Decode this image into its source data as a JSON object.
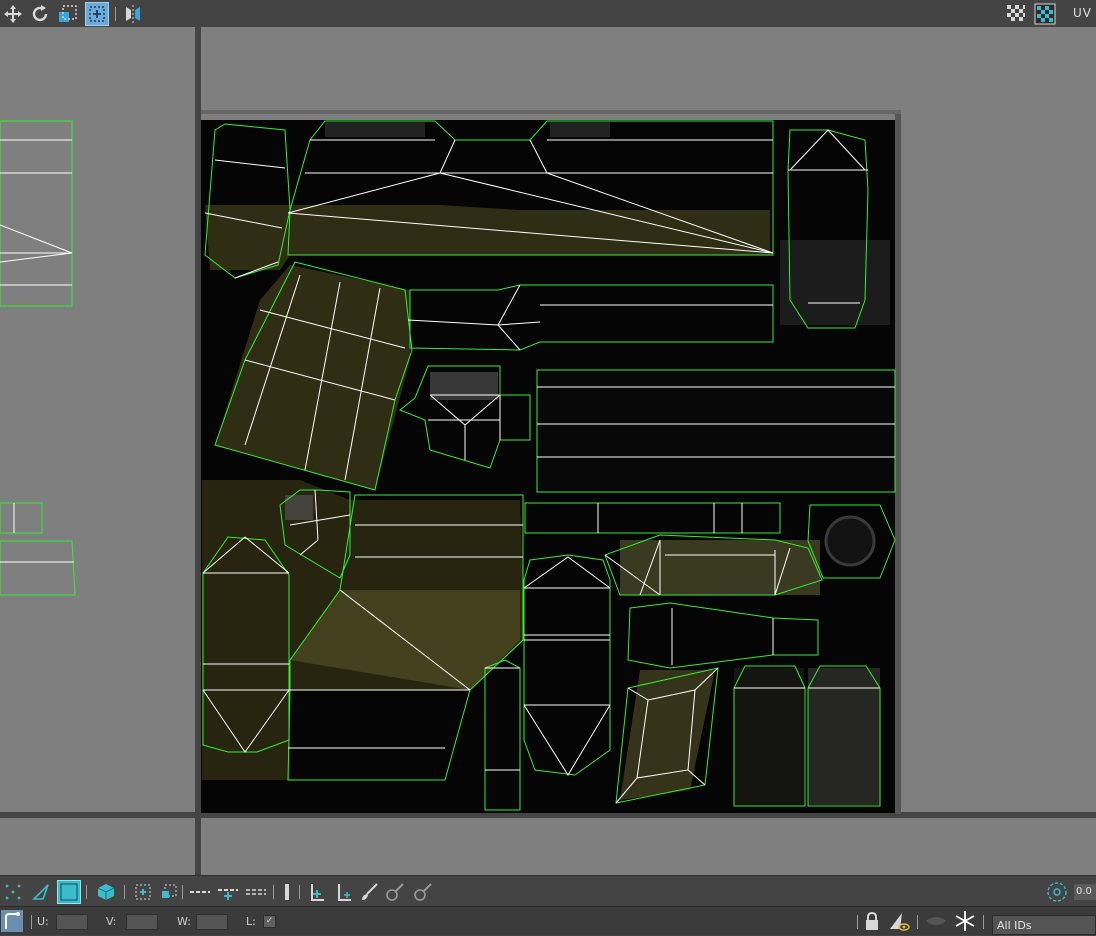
{
  "toolbar": {
    "left_tools": [
      "move-icon",
      "rotate-icon",
      "scale-icon",
      "freeform-icon",
      "mirror-icon"
    ],
    "right_tools": [
      "checker-pattern-icon",
      "texture-map-icon"
    ],
    "uv_label": "UV"
  },
  "viewport": {
    "texture_color": "#000000",
    "uv_edge_color": "#33ee33",
    "seam_color": "#ffffff",
    "background": "#7f7f7f"
  },
  "tool_strip": {
    "tools": [
      "vertex-mode-icon",
      "edge-mode-icon",
      "face-mode-icon",
      "element-mode-icon",
      "select-rect-icon",
      "shrink-select-icon",
      "grow-select-icon",
      "loop-icon",
      "ring-icon",
      "align-vertical-icon",
      "align-horizontal-icon",
      "paint-select-icon",
      "relax-icon",
      "pin-icon"
    ],
    "zoom_value": "0.0"
  },
  "status": {
    "u_label": "U:",
    "v_label": "V:",
    "w_label": "W:",
    "l_label": "L:",
    "u_value": "",
    "v_value": "",
    "w_value": "",
    "lock_checked": true,
    "id_filter": "All IDs"
  }
}
